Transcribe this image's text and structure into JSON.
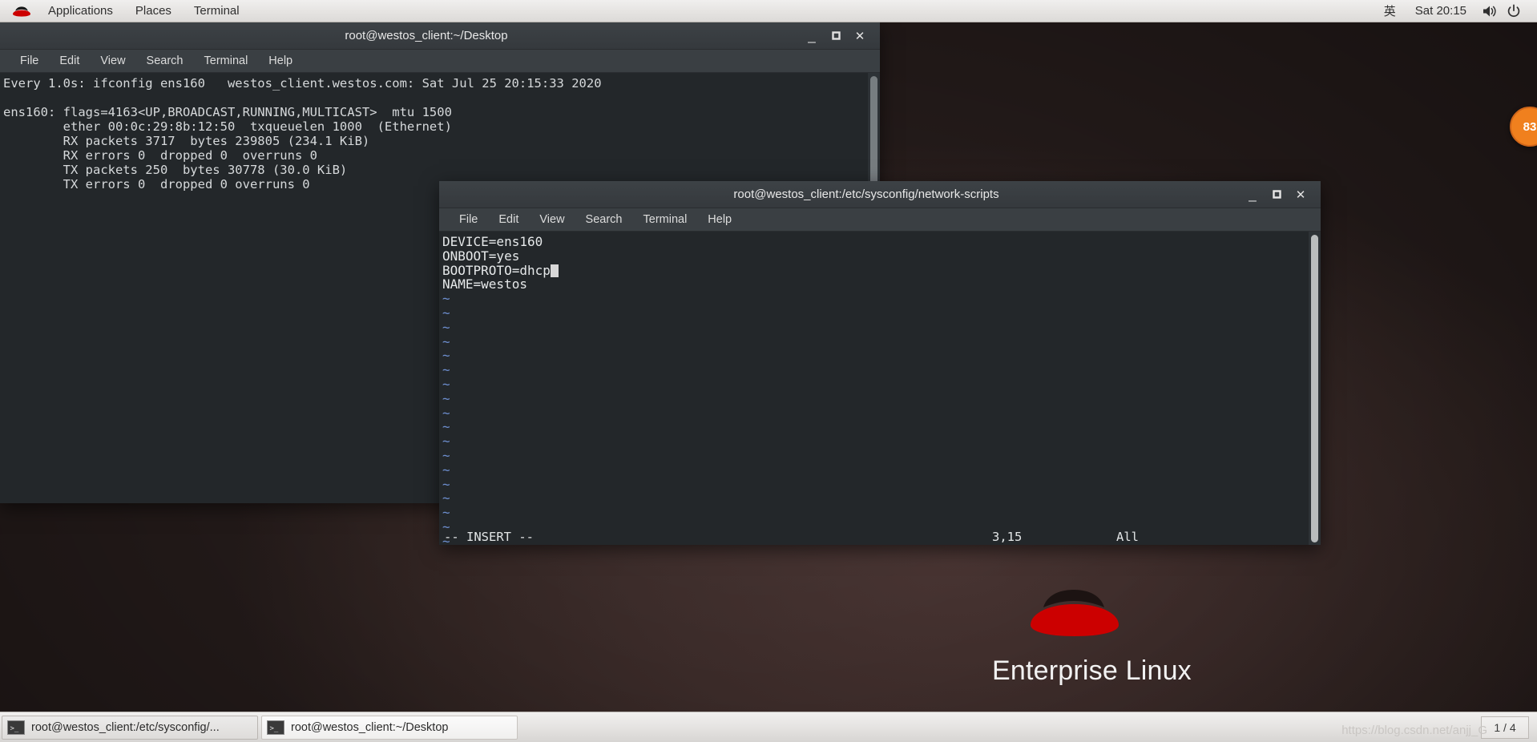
{
  "top_panel": {
    "logo_icon": "redhat-logo-icon",
    "menus": [
      {
        "label": "Applications"
      },
      {
        "label": "Places"
      },
      {
        "label": "Terminal"
      }
    ],
    "input_method": "英",
    "clock": "Sat 20:15",
    "volume_icon": "speaker-icon",
    "power_icon": "power-icon"
  },
  "desktop": {
    "brand_text": "Enterprise Linux",
    "brand_logo_icon": "redhat-shadowman-icon"
  },
  "notification": {
    "badge_count": "83"
  },
  "background_window": {
    "title": "root@westos_client:~/Desktop",
    "menu": [
      "File",
      "Edit",
      "View",
      "Search",
      "Terminal",
      "Help"
    ],
    "window_buttons": {
      "minimize": "_",
      "maximize": "❐",
      "close": "✕"
    },
    "terminal_lines": [
      "Every 1.0s: ifconfig ens160   westos_client.westos.com: Sat Jul 25 20:15:33 2020",
      "",
      "ens160: flags=4163<UP,BROADCAST,RUNNING,MULTICAST>  mtu 1500",
      "        ether 00:0c:29:8b:12:50  txqueuelen 1000  (Ethernet)",
      "        RX packets 3717  bytes 239805 (234.1 KiB)",
      "        RX errors 0  dropped 0  overruns 0",
      "        TX packets 250  bytes 30778 (30.0 KiB)",
      "        TX errors 0  dropped 0 overruns 0"
    ]
  },
  "foreground_window": {
    "title": "root@westos_client:/etc/sysconfig/network-scripts",
    "menu": [
      "File",
      "Edit",
      "View",
      "Search",
      "Terminal",
      "Help"
    ],
    "window_buttons": {
      "minimize": "_",
      "maximize": "❐",
      "close": "✕"
    },
    "editor": {
      "lines": [
        "DEVICE=ens160",
        "ONBOOT=yes",
        "BOOTPROTO=dhcp",
        "NAME=westos"
      ],
      "cursor_line_index": 2,
      "empty_marker": "~",
      "empty_marker_count": 19,
      "status": {
        "mode": "-- INSERT --",
        "position": "3,15",
        "scroll": "All"
      }
    }
  },
  "taskbar": {
    "items": [
      {
        "label": "root@westos_client:/etc/sysconfig/...",
        "icon": "terminal-icon",
        "active": false
      },
      {
        "label": "root@westos_client:~/Desktop",
        "icon": "terminal-icon",
        "active": true
      }
    ],
    "watermark": "https://blog.csdn.net/anjj_G",
    "workspace": "1 / 4"
  }
}
